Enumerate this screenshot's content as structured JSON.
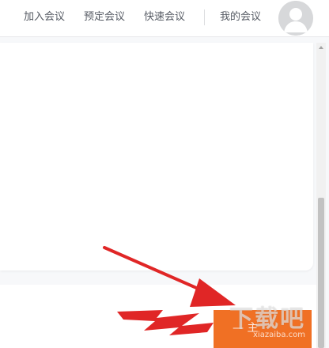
{
  "header": {
    "nav": {
      "join": "加入会议",
      "schedule": "预定会议",
      "quick": "快速会议",
      "mine": "我的会议"
    }
  },
  "icons": {
    "avatar": "user-avatar-placeholder",
    "scroll_up": "triangle-up",
    "arrow_annotation": "red-arrow"
  },
  "bottom": {
    "action_button_label": "— 主"
  },
  "watermark": {
    "brand": "下载吧",
    "url": "xiazaiba.com"
  },
  "colors": {
    "accent_orange": "#f07024",
    "annotation_red": "#e02626",
    "nav_text": "#555a63",
    "page_bg": "#f7f8fa"
  }
}
